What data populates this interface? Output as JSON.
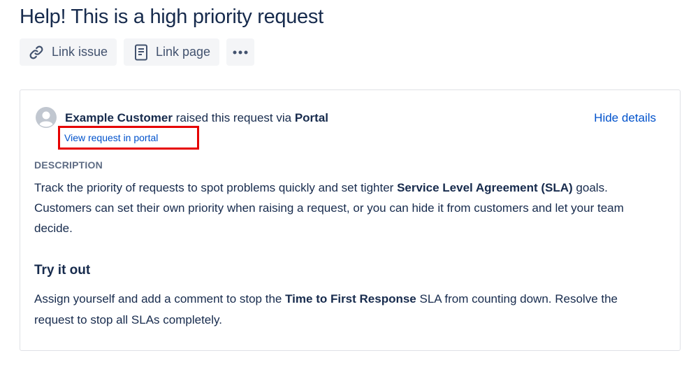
{
  "page": {
    "title": "Help! This is a high priority request"
  },
  "toolbar": {
    "link_issue_label": "Link issue",
    "link_page_label": "Link page",
    "link_issue_icon": "link-icon",
    "link_page_icon": "document-icon",
    "more_icon": "more-horizontal-icon"
  },
  "request": {
    "customer_name": "Example Customer",
    "raised_text": " raised this request via ",
    "channel": "Portal",
    "hide_details_label": "Hide details",
    "view_portal_label": "View request in portal",
    "highlight_color": "#e60000"
  },
  "description": {
    "label": "DESCRIPTION",
    "p1_part1": "Track the priority of requests to spot problems quickly and set tighter ",
    "p1_bold": "Service Level Agreement (SLA)",
    "p1_part2": " goals. Customers can set their own priority when raising a request, or you can hide it from customers and let your team decide.",
    "try_heading": "Try it out",
    "p2_part1": "Assign yourself and add a comment to stop the ",
    "p2_bold": "Time to First Response",
    "p2_part2": " SLA from counting down. Resolve the request to stop all SLAs completely."
  },
  "colors": {
    "text": "#172b4d",
    "link": "#0052cc",
    "button_bg": "#f4f5f7",
    "muted": "#5e6c84"
  }
}
